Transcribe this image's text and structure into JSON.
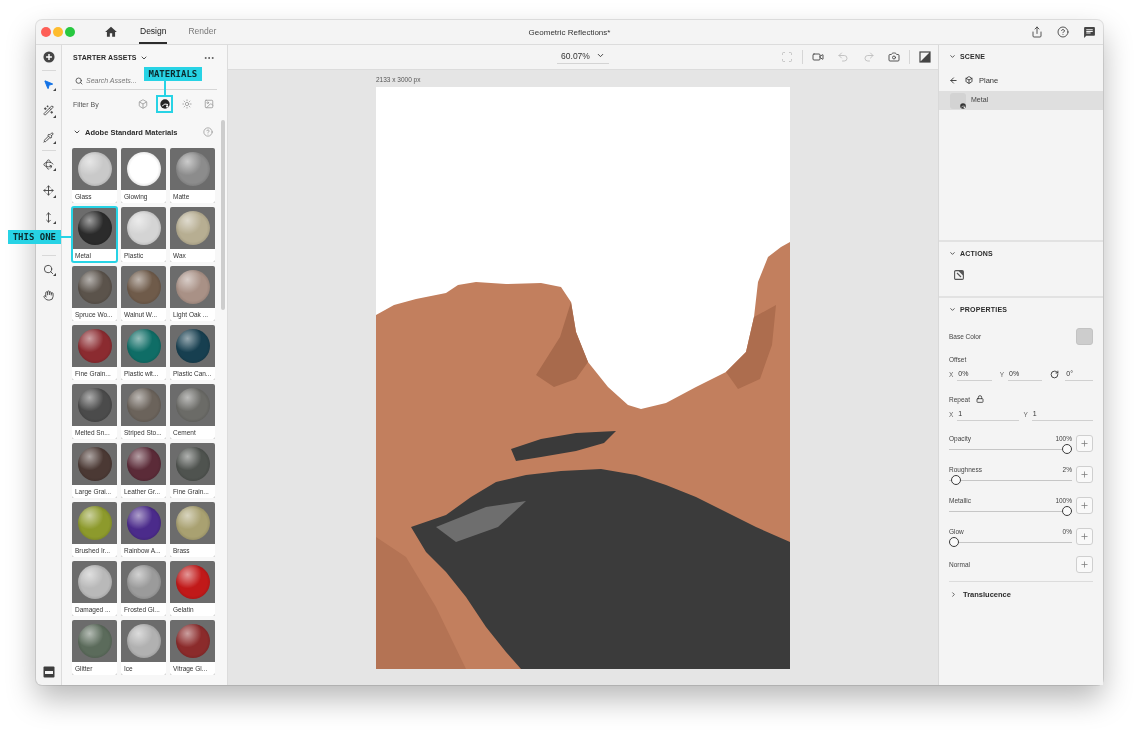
{
  "window": {
    "title": "Geometric Reflections*",
    "tabs": [
      {
        "label": "Design",
        "selected": true
      },
      {
        "label": "Render",
        "selected": false
      }
    ]
  },
  "left_toolbar": {
    "tools": [
      {
        "selected": false
      },
      {
        "selected": true
      },
      {
        "selected": false
      },
      {
        "selected": false
      },
      {
        "selected": false
      },
      {
        "selected": false
      },
      {
        "selected": false
      },
      {
        "selected": false
      },
      {
        "selected": false
      }
    ]
  },
  "assets_panel": {
    "title": "STARTER ASSETS",
    "search": {
      "placeholder": "Search Assets..."
    },
    "filter": {
      "label": "Filter By",
      "options": [
        {
          "selected": false
        },
        {
          "selected": true,
          "callout": "MATERIALS"
        },
        {
          "selected": false
        },
        {
          "selected": false
        }
      ]
    },
    "section": {
      "title": "Adobe Standard Materials",
      "expanded": true,
      "materials": [
        {
          "name": "Glass",
          "color": "#c9c9c9"
        },
        {
          "name": "Glowing",
          "color": "#ffffff"
        },
        {
          "name": "Matte",
          "color": "#8c8c8c"
        },
        {
          "name": "Metal",
          "color": "#2b2b2b",
          "callout": "THIS ONE"
        },
        {
          "name": "Plastic",
          "color": "#d4d4d4"
        },
        {
          "name": "Wax",
          "color": "#b7ae92"
        },
        {
          "name": "Spruce Wo...",
          "color": "#5b534b"
        },
        {
          "name": "Walnut W...",
          "color": "#6f5b4a"
        },
        {
          "name": "Light Oak ...",
          "color": "#a99186"
        },
        {
          "name": "Fine Grain...",
          "color": "#8b2b30"
        },
        {
          "name": "Plastic wit...",
          "color": "#0f6d66"
        },
        {
          "name": "Plastic Can...",
          "color": "#173f50"
        },
        {
          "name": "Melted Sn...",
          "color": "#4b4b4b"
        },
        {
          "name": "Striped Sto...",
          "color": "#6b635b"
        },
        {
          "name": "Cement",
          "color": "#6b6b67"
        },
        {
          "name": "Large Grai...",
          "color": "#4b3934"
        },
        {
          "name": "Leather Gr...",
          "color": "#5b2b38"
        },
        {
          "name": "Fine Grain...",
          "color": "#4f534f"
        },
        {
          "name": "Brushed Ir...",
          "color": "#8d9a2c"
        },
        {
          "name": "Rainbow A...",
          "color": "#4b2b8b"
        },
        {
          "name": "Brass",
          "color": "#a9a171"
        },
        {
          "name": "Damaged ...",
          "color": "#b9b9b9"
        },
        {
          "name": "Frosted Gl...",
          "color": "#9b9b9b"
        },
        {
          "name": "Gelatin",
          "color": "#c11919"
        },
        {
          "name": "Glitter",
          "color": "#5b6b5b"
        },
        {
          "name": "Ice",
          "color": "#b1b1b1"
        },
        {
          "name": "Vitrage Gl...",
          "color": "#8b2b2b"
        }
      ]
    }
  },
  "canvas": {
    "zoom": "60.07%",
    "tools": [
      {
        "disabled": true
      },
      {
        "disabled": false
      },
      {
        "disabled": true
      },
      {
        "disabled": true
      },
      {
        "disabled": false
      },
      {
        "disabled": false
      }
    ],
    "document_size": "2133 x 3000 px"
  },
  "right_panel": {
    "scene": {
      "title": "SCENE",
      "expanded": true,
      "parent": "Plane",
      "items": [
        {
          "name": "Metal",
          "selected": true
        }
      ]
    },
    "actions": {
      "title": "ACTIONS",
      "expanded": true
    },
    "properties": {
      "title": "PROPERTIES",
      "expanded": true,
      "base_color": {
        "label": "Base Color"
      },
      "offset": {
        "label": "Offset",
        "fields": [
          {
            "kind": "axis",
            "label": "X",
            "value": "0%"
          },
          {
            "kind": "axis",
            "label": "Y",
            "value": "0%"
          },
          {
            "kind": "rotation",
            "value": "0°"
          }
        ]
      },
      "repeat": {
        "label": "Repeat",
        "locked": true,
        "fields": [
          {
            "kind": "axis",
            "label": "X",
            "value": "1"
          },
          {
            "kind": "axis",
            "label": "Y",
            "value": "1"
          }
        ]
      },
      "sliders": [
        {
          "label": "Opacity",
          "reading": "100%",
          "level": 1
        },
        {
          "label": "Roughness",
          "reading": "2%",
          "level": 0.02
        },
        {
          "label": "Metallic",
          "reading": "100%",
          "level": 1
        },
        {
          "label": "Glow",
          "reading": "0%",
          "level": 0
        }
      ],
      "normal": {
        "label": "Normal"
      }
    },
    "translucence": {
      "title": "Translucence",
      "expanded": false
    }
  }
}
